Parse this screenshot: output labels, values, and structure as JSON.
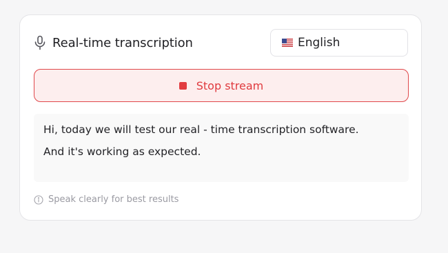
{
  "header": {
    "icon": "microphone-icon",
    "title": "Real-time transcription"
  },
  "language_select": {
    "flag_icon": "us-flag-icon",
    "selected": "English"
  },
  "stop_button": {
    "icon": "stop-square-icon",
    "label": "Stop stream",
    "color": "#e03a3e"
  },
  "transcript": {
    "lines": [
      "Hi, today we will test our real - time transcription software.",
      "And it's working as expected."
    ]
  },
  "hint": {
    "icon": "info-icon",
    "text": "Speak clearly for best results"
  }
}
